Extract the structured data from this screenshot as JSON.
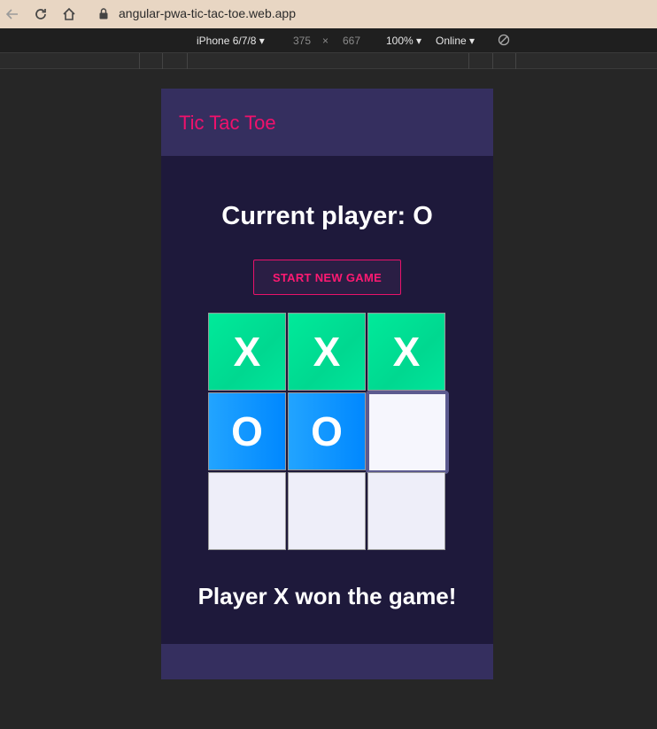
{
  "browser": {
    "url": "angular-pwa-tic-tac-toe.web.app"
  },
  "device_toolbar": {
    "device": "iPhone 6/7/8",
    "width": "375",
    "times": "×",
    "height": "667",
    "zoom": "100%",
    "network": "Online",
    "dropdown_arrow": "▾"
  },
  "app": {
    "title": "Tic Tac Toe",
    "current_player": "Current player: O",
    "new_game_label": "START NEW GAME",
    "status": "Player X won the game!",
    "board": [
      "X",
      "X",
      "X",
      "O",
      "O",
      "",
      "",
      "",
      ""
    ]
  },
  "colors": {
    "accent": "#f0116c",
    "x_cell": "#00e396",
    "o_cell": "#0a91ff",
    "empty_cell": "#eeeef9",
    "header": "#352f5f",
    "background": "#1e193b"
  }
}
